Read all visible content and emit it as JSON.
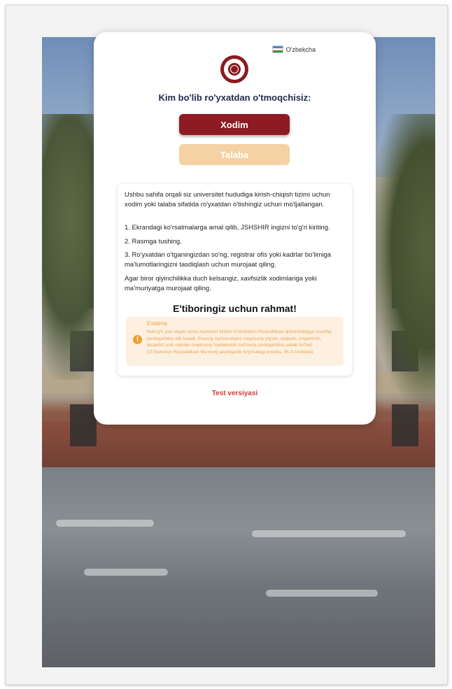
{
  "language": {
    "label": "O'zbekcha",
    "flag_icon": "uz-flag-icon"
  },
  "logo_icon": "university-seal-icon",
  "heading": "Kim bo'lib ro'yxatdan o'tmoqchisiz:",
  "buttons": {
    "staff": "Xodim",
    "student": "Talaba"
  },
  "info": {
    "intro": "Ushbu sahifa orqali siz universitet hududiga kirish-chiqish tizimi uchun xodim yoki talaba sifatida ro'yxatdan o'tishingiz uchun mo'ljallangan.",
    "step1": "1. Ekrandagi ko'rsatmalarga amal qilib, JSHSHIR ingizni to'g'ri kiriting.",
    "step2": "2. Rasmga tushing.",
    "step3": "3. Ro'yxatdan o'tganingizdan so'ng, registrar ofis yoki kadrlar bo'limiga ma'lumotlaringizni tasdiqlash uchun murojaat qiling.",
    "help": "Agar biror qiyinchilikka duch kelsangiz, xavfsizlik xodimlariga yoki ma'muriyatga murojaat qiling.",
    "thanks": "E'tiboringiz uchun rahmat!"
  },
  "note": {
    "title": "Eslatma",
    "text": "Noto'g'ri yoki atayin soxta ma'lumot kiritish O'zbekiston Respublikasi qonunchiligiga muvofiq javobgarlikka olib keladi. Shaxsiy ma'lumotlarni noqonuniy yig'ish, saqlash, o'zgartirish, tarqatish yoki ulardan noqonuniy foydalanish ma'muriy javobgarlikka sabab bo'ladi (O'zbekiston Respublikasi Ma'muriy javobgarlik to'g'risidagi kodeks, 46-2-moddasi).",
    "icon": "exclamation-icon",
    "color": "#e9a44a"
  },
  "footer": {
    "version": "Test versiyasi"
  },
  "colors": {
    "primary": "#8e1b23",
    "secondary": "#f4d2a4",
    "heading": "#1f2a4d",
    "version": "#d33b3b"
  }
}
